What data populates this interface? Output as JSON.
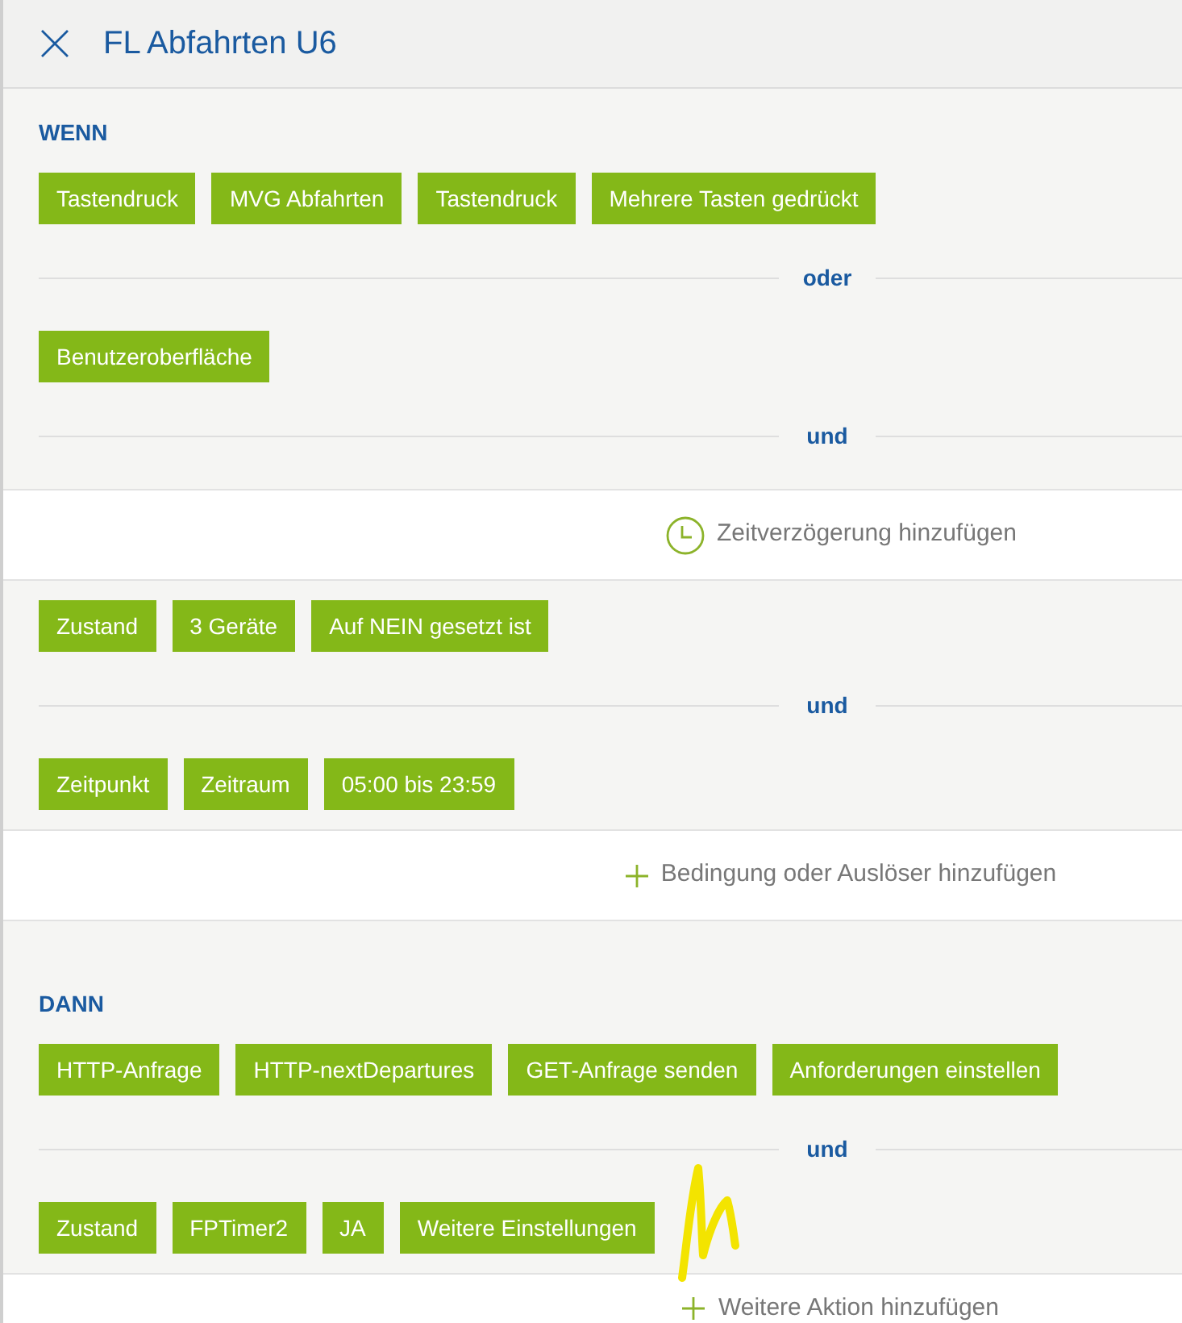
{
  "header": {
    "title": "FL Abfahrten U6"
  },
  "sections": [
    {
      "heading": "WENN",
      "blocks": [
        {
          "kind": "chips",
          "chips": [
            "Tastendruck",
            "MVG Abfahrten",
            "Tastendruck",
            "Mehrere Tasten gedrückt"
          ]
        },
        {
          "kind": "divider",
          "label": "oder"
        },
        {
          "kind": "chips",
          "chips": [
            "Benutzeroberfläche"
          ]
        },
        {
          "kind": "divider",
          "label": "und"
        },
        {
          "kind": "delay_action",
          "label": "Zeitverzögerung hinzufügen"
        },
        {
          "kind": "chips",
          "chips": [
            "Zustand",
            "3 Geräte",
            "Auf NEIN gesetzt ist"
          ]
        },
        {
          "kind": "divider",
          "label": "und"
        },
        {
          "kind": "chips",
          "chips": [
            "Zeitpunkt",
            "Zeitraum",
            "05:00 bis 23:59"
          ]
        },
        {
          "kind": "add_action",
          "label": "Bedingung oder Auslöser hinzufügen"
        }
      ]
    },
    {
      "heading": "DANN",
      "blocks": [
        {
          "kind": "chips",
          "chips": [
            "HTTP-Anfrage",
            "HTTP-nextDepartures",
            "GET-Anfrage senden",
            "Anforderungen einstellen"
          ]
        },
        {
          "kind": "divider",
          "label": "und"
        },
        {
          "kind": "chips",
          "chips": [
            "Zustand",
            "FPTimer2",
            "JA",
            "Weitere Einstellungen"
          ]
        },
        {
          "kind": "add_action",
          "label": "Weitere Aktion hinzufügen"
        }
      ]
    }
  ]
}
